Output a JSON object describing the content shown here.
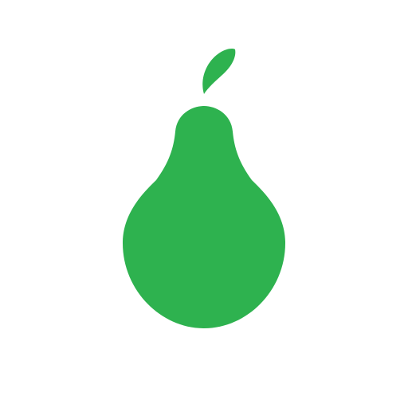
{
  "icon": {
    "name": "pear-icon",
    "colors": {
      "background": "#ffffff",
      "fruit": "#2eb24f"
    }
  }
}
